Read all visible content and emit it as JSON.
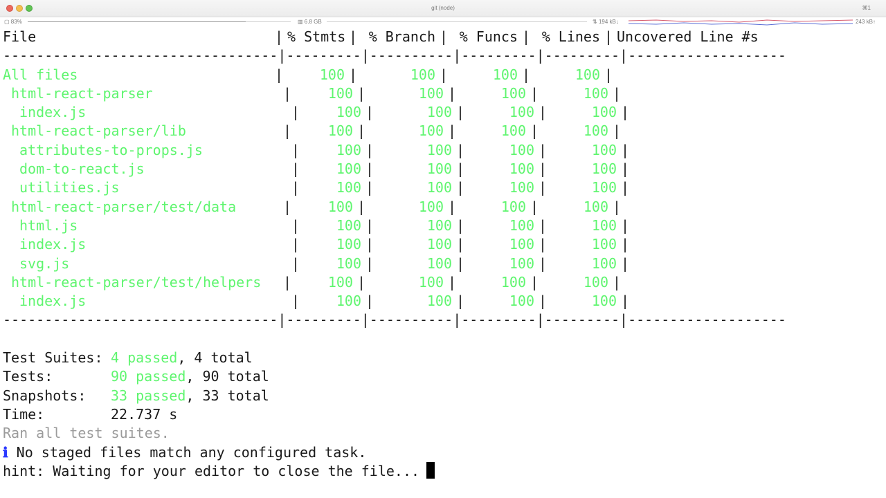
{
  "window": {
    "title": "git (node)",
    "shortcut": "⌘1"
  },
  "statusbar": {
    "battery": "83%",
    "memory": "6.8 GB",
    "net_down": "194 kB↓",
    "net_up": "243 kB↑",
    "battery_level_pct": 83
  },
  "coverage": {
    "headers": {
      "file": "File",
      "stmts": "% Stmts",
      "branch": "% Branch",
      "funcs": "% Funcs",
      "lines": "% Lines",
      "uncovered": "Uncovered Line #s"
    },
    "divider": "---------------------------------|---------|----------|---------|---------|-------------------",
    "rows": [
      {
        "file": "All files",
        "indent": 0,
        "stmts": "100",
        "branch": "100",
        "funcs": "100",
        "lines": "100",
        "uncovered": ""
      },
      {
        "file": "html-react-parser",
        "indent": 1,
        "stmts": "100",
        "branch": "100",
        "funcs": "100",
        "lines": "100",
        "uncovered": ""
      },
      {
        "file": "index.js",
        "indent": 2,
        "stmts": "100",
        "branch": "100",
        "funcs": "100",
        "lines": "100",
        "uncovered": ""
      },
      {
        "file": "html-react-parser/lib",
        "indent": 1,
        "stmts": "100",
        "branch": "100",
        "funcs": "100",
        "lines": "100",
        "uncovered": ""
      },
      {
        "file": "attributes-to-props.js",
        "indent": 2,
        "stmts": "100",
        "branch": "100",
        "funcs": "100",
        "lines": "100",
        "uncovered": ""
      },
      {
        "file": "dom-to-react.js",
        "indent": 2,
        "stmts": "100",
        "branch": "100",
        "funcs": "100",
        "lines": "100",
        "uncovered": ""
      },
      {
        "file": "utilities.js",
        "indent": 2,
        "stmts": "100",
        "branch": "100",
        "funcs": "100",
        "lines": "100",
        "uncovered": ""
      },
      {
        "file": "html-react-parser/test/data",
        "indent": 1,
        "stmts": "100",
        "branch": "100",
        "funcs": "100",
        "lines": "100",
        "uncovered": ""
      },
      {
        "file": "html.js",
        "indent": 2,
        "stmts": "100",
        "branch": "100",
        "funcs": "100",
        "lines": "100",
        "uncovered": ""
      },
      {
        "file": "index.js",
        "indent": 2,
        "stmts": "100",
        "branch": "100",
        "funcs": "100",
        "lines": "100",
        "uncovered": ""
      },
      {
        "file": "svg.js",
        "indent": 2,
        "stmts": "100",
        "branch": "100",
        "funcs": "100",
        "lines": "100",
        "uncovered": ""
      },
      {
        "file": "html-react-parser/test/helpers",
        "indent": 1,
        "stmts": "100",
        "branch": "100",
        "funcs": "100",
        "lines": "100",
        "uncovered": ""
      },
      {
        "file": "index.js",
        "indent": 2,
        "stmts": "100",
        "branch": "100",
        "funcs": "100",
        "lines": "100",
        "uncovered": ""
      }
    ]
  },
  "summary": {
    "suites_label": "Test Suites:",
    "suites_passed": "4 passed",
    "suites_total": ", 4 total",
    "tests_label": "Tests:",
    "tests_passed": "90 passed",
    "tests_total": ", 90 total",
    "snapshots_label": "Snapshots:",
    "snapshots_passed": "33 passed",
    "snapshots_total": ", 33 total",
    "time_label": "Time:",
    "time_value": "22.737 s",
    "ran_all": "Ran all test suites."
  },
  "messages": {
    "info_icon": "ℹ",
    "no_staged": "No staged files match any configured task.",
    "hint": "hint: Waiting for your editor to close the file..."
  },
  "colors": {
    "pass_green": "#5ff56f",
    "dim_gray": "#9b9b9b",
    "info_blue": "#2b39ff",
    "text": "#1a1a1a"
  }
}
